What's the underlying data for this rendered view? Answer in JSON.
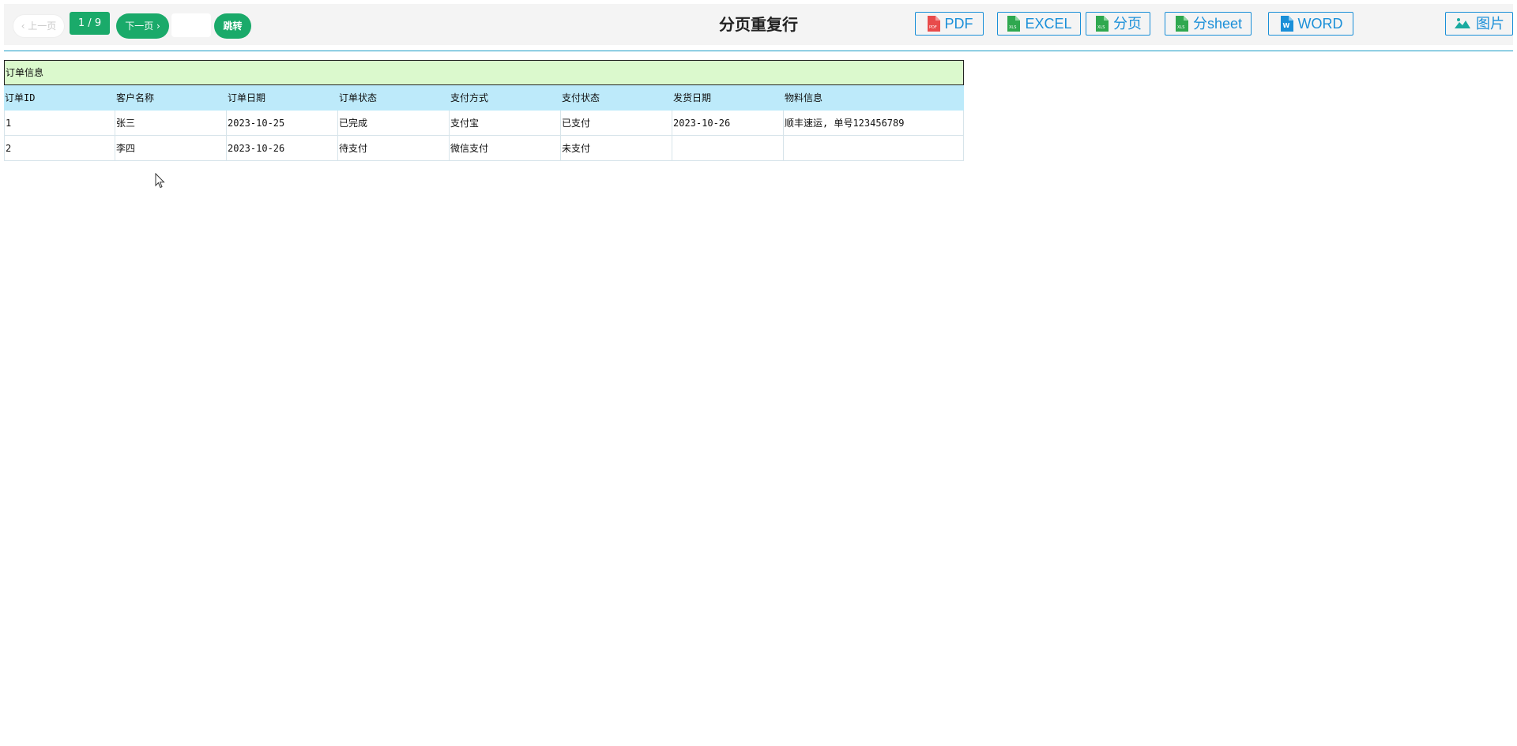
{
  "toolbar": {
    "prev_label": "‹ 上一页",
    "page_indicator": "1 / 9",
    "next_label": "下一页 ›",
    "jump_input_value": "",
    "jump_label": "跳转",
    "title": "分页重复行",
    "exports": [
      {
        "icon": "pdf-file-icon",
        "label": "PDF",
        "color": "#e84b4b"
      },
      {
        "icon": "excel-file-icon",
        "label": "EXCEL",
        "color": "#2fa84f"
      },
      {
        "icon": "excel-file-icon",
        "label": "分页",
        "color": "#2fa84f"
      },
      {
        "icon": "excel-file-icon",
        "label": "分sheet",
        "color": "#2fa84f"
      },
      {
        "icon": "word-file-icon",
        "label": "WORD",
        "color": "#1a8fd8"
      },
      {
        "icon": "image-icon",
        "label": "图片",
        "color": "#1aaaa0"
      }
    ]
  },
  "report": {
    "group_title": "订单信息",
    "columns": [
      "订单ID",
      "客户名称",
      "订单日期",
      "订单状态",
      "支付方式",
      "支付状态",
      "发货日期",
      "物料信息"
    ],
    "rows": [
      [
        "1",
        "张三",
        "2023-10-25",
        "已完成",
        "支付宝",
        "已支付",
        "2023-10-26",
        "顺丰速运, 单号123456789"
      ],
      [
        "2",
        "李四",
        "2023-10-26",
        "待支付",
        "微信支付",
        "未支付",
        "",
        ""
      ]
    ]
  },
  "colors": {
    "accent_green": "#1aaa6a",
    "export_blue": "#1a8fd8",
    "group_header_bg": "#dbf9cd",
    "column_header_bg": "#bdeafa",
    "toolbar_rule": "#1a9cc5"
  }
}
